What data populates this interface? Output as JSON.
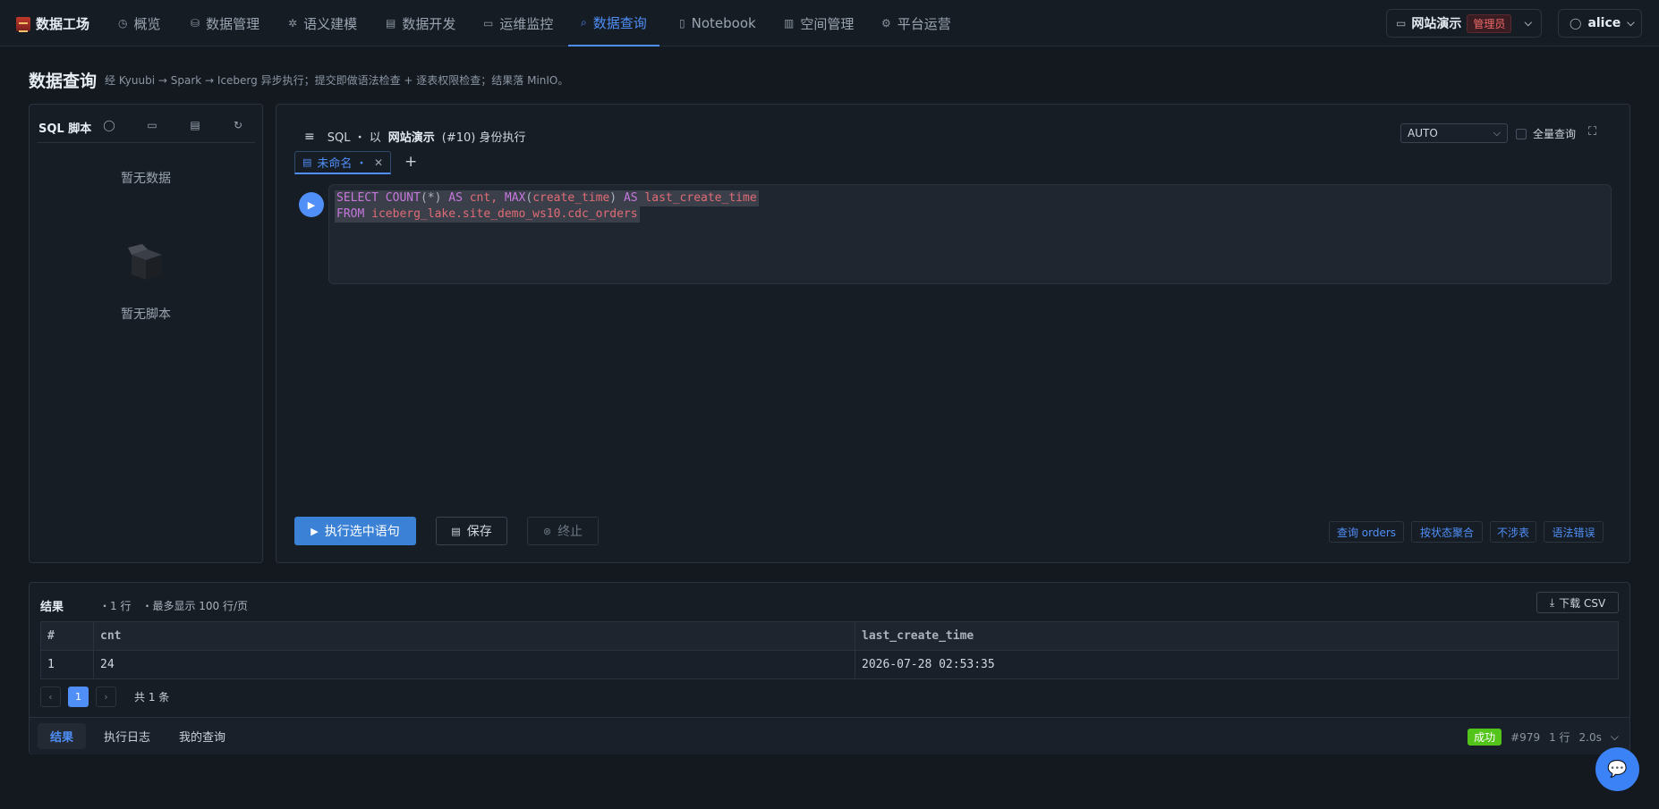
{
  "nav": {
    "brand": "数据工场",
    "items": [
      {
        "label": "概览",
        "icon": "clock-icon"
      },
      {
        "label": "数据管理",
        "icon": "database-icon"
      },
      {
        "label": "语义建模",
        "icon": "sparkle-icon"
      },
      {
        "label": "数据开发",
        "icon": "code-file-icon"
      },
      {
        "label": "运维监控",
        "icon": "monitor-icon"
      },
      {
        "label": "数据查询",
        "icon": "search-icon",
        "active": true
      },
      {
        "label": "Notebook",
        "icon": "notebook-icon"
      },
      {
        "label": "空间管理",
        "icon": "building-icon"
      },
      {
        "label": "平台运营",
        "icon": "gear-icon"
      }
    ],
    "workspace": "网站演示",
    "role_badge": "管理员",
    "user": "alice"
  },
  "page": {
    "title": "数据查询",
    "subtitle": "经 Kyuubi → Spark → Iceberg 异步执行；提交即做语法检查 + 逐表权限检查；结果落 MinIO。"
  },
  "scripts_panel": {
    "title": "SQL 脚本",
    "empty_data": "暂无数据",
    "empty_scripts": "暂无脚本"
  },
  "editor": {
    "prefix": "SQL ・ 以",
    "workspace": "网站演示",
    "identity": "(#10) 身份执行",
    "engine": "AUTO",
    "full_query_label": "全量查询",
    "tab_label": "未命名 ・",
    "code": [
      [
        {
          "t": "SELECT",
          "c": "kw"
        },
        {
          "t": " ",
          "c": "op"
        },
        {
          "t": "COUNT",
          "c": "kw"
        },
        {
          "t": "(*) ",
          "c": "op"
        },
        {
          "t": "AS",
          "c": "kw"
        },
        {
          "t": " cnt, ",
          "c": "id"
        },
        {
          "t": "MAX",
          "c": "kw"
        },
        {
          "t": "(",
          "c": "op"
        },
        {
          "t": "create_time",
          "c": "id"
        },
        {
          "t": ") ",
          "c": "op"
        },
        {
          "t": "AS",
          "c": "kw"
        },
        {
          "t": " last_create_time",
          "c": "id"
        }
      ],
      [
        {
          "t": "FROM",
          "c": "kw"
        },
        {
          "t": " iceberg_lake.site_demo_ws10.cdc_orders",
          "c": "id"
        }
      ]
    ],
    "run_label": "执行选中语句",
    "save_label": "保存",
    "stop_label": "终止",
    "quick_tags": [
      "查询 orders",
      "按状态聚合",
      "不涉表",
      "语法错误"
    ]
  },
  "results": {
    "title": "结果",
    "row_count": "・1 行",
    "page_limit": "・最多显示 100 行/页",
    "download_label": "下载 CSV",
    "columns": [
      "#",
      "cnt",
      "last_create_time"
    ],
    "rows": [
      [
        "1",
        "24",
        "2026-07-28 02:53:35"
      ]
    ],
    "current_page": "1",
    "total": "共 1 条",
    "footer_tabs": [
      "结果",
      "执行日志",
      "我的查询"
    ],
    "status": "成功",
    "query_id": "#979",
    "rows_label": "1 行",
    "duration": "2.0s"
  },
  "colors": {
    "accent": "#4f8ff7",
    "success": "#52c41a",
    "admin_badge": "#f06a6a",
    "sql_keyword": "#c678dd",
    "sql_identifier": "#e06c75"
  }
}
